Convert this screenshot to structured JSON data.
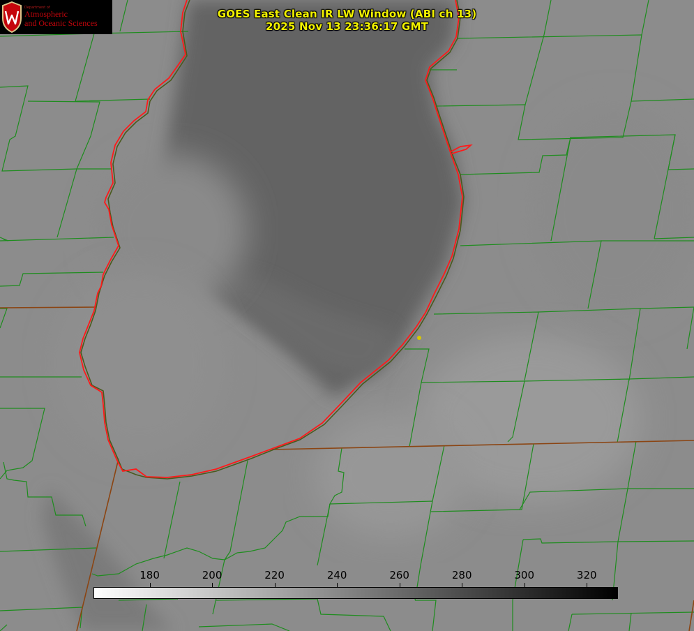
{
  "title": {
    "line1": "GOES East Clean IR LW Window (ABI ch 13)",
    "line2": "2025 Nov 13 23:36:17 GMT"
  },
  "logo": {
    "dept": "Department of",
    "line1": "Atmospheric",
    "line2": "and Oceanic Sciences",
    "icon": "uw-crest-icon"
  },
  "colorbar": {
    "ticks": [
      "180",
      "200",
      "220",
      "240",
      "260",
      "280",
      "300",
      "320"
    ],
    "min_value": 162,
    "max_value": 330,
    "gradient_from": "#ffffff",
    "gradient_to": "#000000"
  },
  "colors": {
    "county_lines": "#1e8c1e",
    "state_lines": "#8b4513",
    "lake_outline": "#ff1a1a",
    "title_text": "#f2f200",
    "station_marker": "#d8c800"
  }
}
